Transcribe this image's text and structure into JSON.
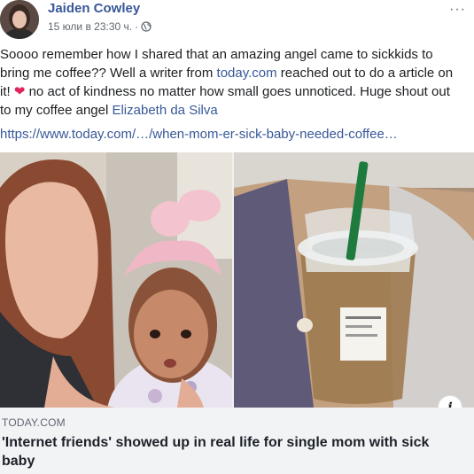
{
  "post": {
    "author": "Jaiden Cowley",
    "timestamp": "15 юли в 23:30 ч.",
    "separator": "·",
    "audience_icon": "globe-icon",
    "more_label": "···",
    "text": {
      "part1": "Soooo remember how I shared that an amazing angel came to sickkids to bring me coffee?? Well a writer from ",
      "link": "today.com",
      "part2": " reached out to do a article on it! ",
      "heart": "❤",
      "part3": " no act of kindness no matter how small goes unnoticed. Huge shout out to my coffee angel ",
      "mention": "Elizabeth da Silva"
    },
    "url": "https://www.today.com/…/when-mom-er-sick-baby-needed-coffee…"
  },
  "link_preview": {
    "source": "TODAY.COM",
    "title": "'Internet friends' showed up in real life for single mom with sick baby",
    "info_label": "i"
  },
  "colors": {
    "link": "#385898",
    "heart": "#e0245e",
    "card_bg": "#f2f3f5"
  }
}
